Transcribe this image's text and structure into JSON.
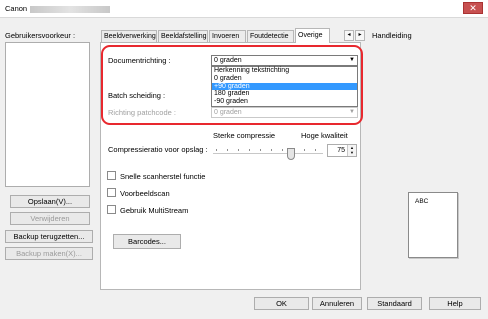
{
  "window": {
    "title": "Canon",
    "close_glyph": "✕"
  },
  "sidebar": {
    "label": "Gebruikersvoorkeur :",
    "buttons": {
      "save": "Opslaan(V)...",
      "delete": "Verwijderen",
      "restore": "Backup terugzetten...",
      "backup": "Backup maken(X)..."
    }
  },
  "tabs": [
    {
      "label": "Beeldverwerking"
    },
    {
      "label": "Beeldafstelling"
    },
    {
      "label": "Invoeren"
    },
    {
      "label": "Foutdetectie"
    },
    {
      "label": "Overige"
    }
  ],
  "tab_nav": {
    "left": "◂",
    "right": "▸"
  },
  "help_panel": {
    "label": "Handleiding",
    "preview_text": "ABC"
  },
  "form": {
    "doc_orientation_label": "Documentrichting :",
    "doc_orientation_value": "0 graden",
    "dropdown_options": [
      "Herkenning tekstrichting",
      "0 graden",
      "+90 graden",
      "180 graden",
      "-90 graden"
    ],
    "selected_option_index": 2,
    "batch_label": "Batch scheiding :",
    "patch_label": "Richting patchcode :",
    "patch_value": "0 graden",
    "compression_high": "Sterke compressie",
    "compression_quality": "Hoge kwaliteit",
    "compression_label": "Compressieratio voor opslag :",
    "compression_value": "75",
    "fast_restore_label": "Snelle scanherstel functie",
    "preview_scan_label": "Voorbeeldscan",
    "multistream_label": "Gebruik MultiStream",
    "barcodes_button": "Barcodes..."
  },
  "footer": {
    "ok": "OK",
    "cancel": "Annuleren",
    "default": "Standaard",
    "help": "Help"
  },
  "colors": {
    "highlight_box": "#e8282e",
    "selection": "#3399ff"
  }
}
